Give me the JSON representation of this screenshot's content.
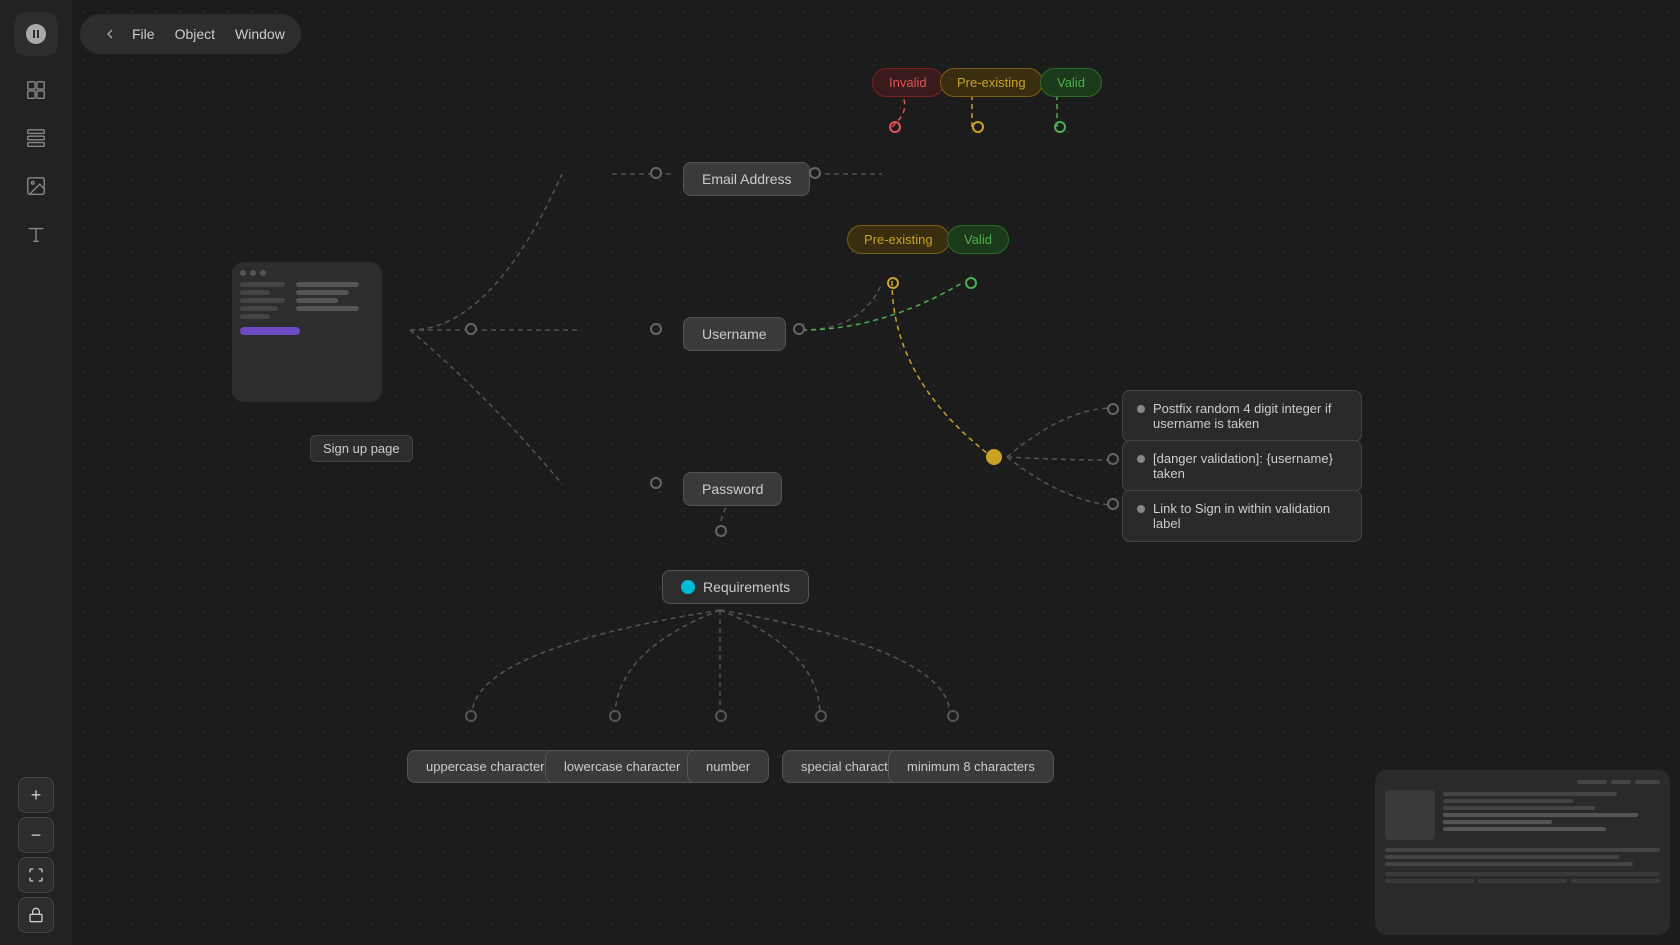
{
  "app": {
    "title": "File Object Window"
  },
  "topbar": {
    "back_label": "←",
    "menu_items": [
      "File",
      "Object",
      "Window"
    ]
  },
  "sidebar": {
    "tools": [
      {
        "name": "component-icon",
        "symbol": "⊞"
      },
      {
        "name": "grid-icon",
        "symbol": "⊟"
      },
      {
        "name": "image-icon",
        "symbol": "⊡"
      },
      {
        "name": "text-icon",
        "symbol": "T"
      }
    ],
    "bottom_tools": [
      {
        "name": "zoom-in-icon",
        "symbol": "+"
      },
      {
        "name": "zoom-out-icon",
        "symbol": "−"
      },
      {
        "name": "fit-icon",
        "symbol": "⊠"
      },
      {
        "name": "lock-icon",
        "symbol": "🔒"
      }
    ]
  },
  "nodes": {
    "email_address": "Email Address",
    "username": "Username",
    "password": "Password",
    "requirements": "Requirements",
    "invalid": "Invalid",
    "preexisting": "Pre-existing",
    "valid_email": "Valid",
    "preexisting_username": "Pre-existing",
    "valid_username": "Valid",
    "uppercase": "uppercase character",
    "lowercase": "lowercase character",
    "number": "number",
    "special": "special character",
    "minimum": "minimum 8 characters"
  },
  "info_boxes": {
    "postfix": "Postfix random 4 digit integer if username is taken",
    "danger": "[danger validation]: {username} taken",
    "link_signin": "Link to Sign in within validation label"
  },
  "signup_page": {
    "label": "Sign up page"
  }
}
